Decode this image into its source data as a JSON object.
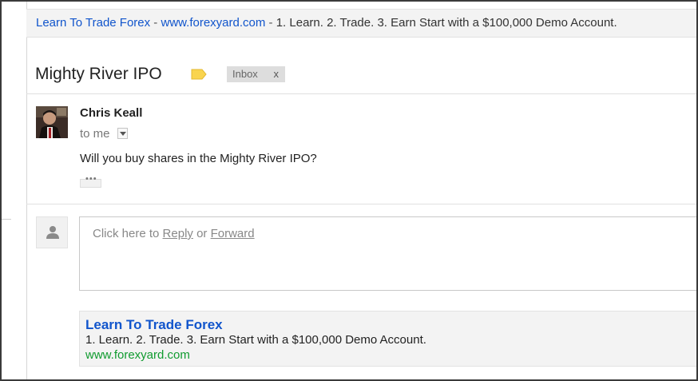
{
  "top_ad": {
    "title": "Learn To Trade Forex",
    "separator1": " - ",
    "url": "www.forexyard.com",
    "separator2": " - ",
    "description": "1. Learn. 2. Trade. 3. Earn Start with a $100,000 Demo Account."
  },
  "thread": {
    "subject": "Mighty River IPO",
    "label_color": "#f9d44e",
    "inbox_label": "Inbox",
    "inbox_remove": "x"
  },
  "message": {
    "sender": "Chris Keall",
    "recipient_text": "to me",
    "body": "Will you buy shares in the Mighty River IPO?",
    "trimmed_indicator": "•••"
  },
  "reply": {
    "prefix": "Click here to ",
    "reply_link": "Reply",
    "middle": " or ",
    "forward_link": "Forward"
  },
  "bottom_ad": {
    "title": "Learn To Trade Forex",
    "description": "1. Learn. 2. Trade. 3. Earn Start with a $100,000 Demo Account.",
    "url": "www.forexyard.com"
  },
  "colors": {
    "link_blue": "#1155cc",
    "ad_url_green": "#109b2f",
    "ad_background": "#f3f3f3"
  }
}
